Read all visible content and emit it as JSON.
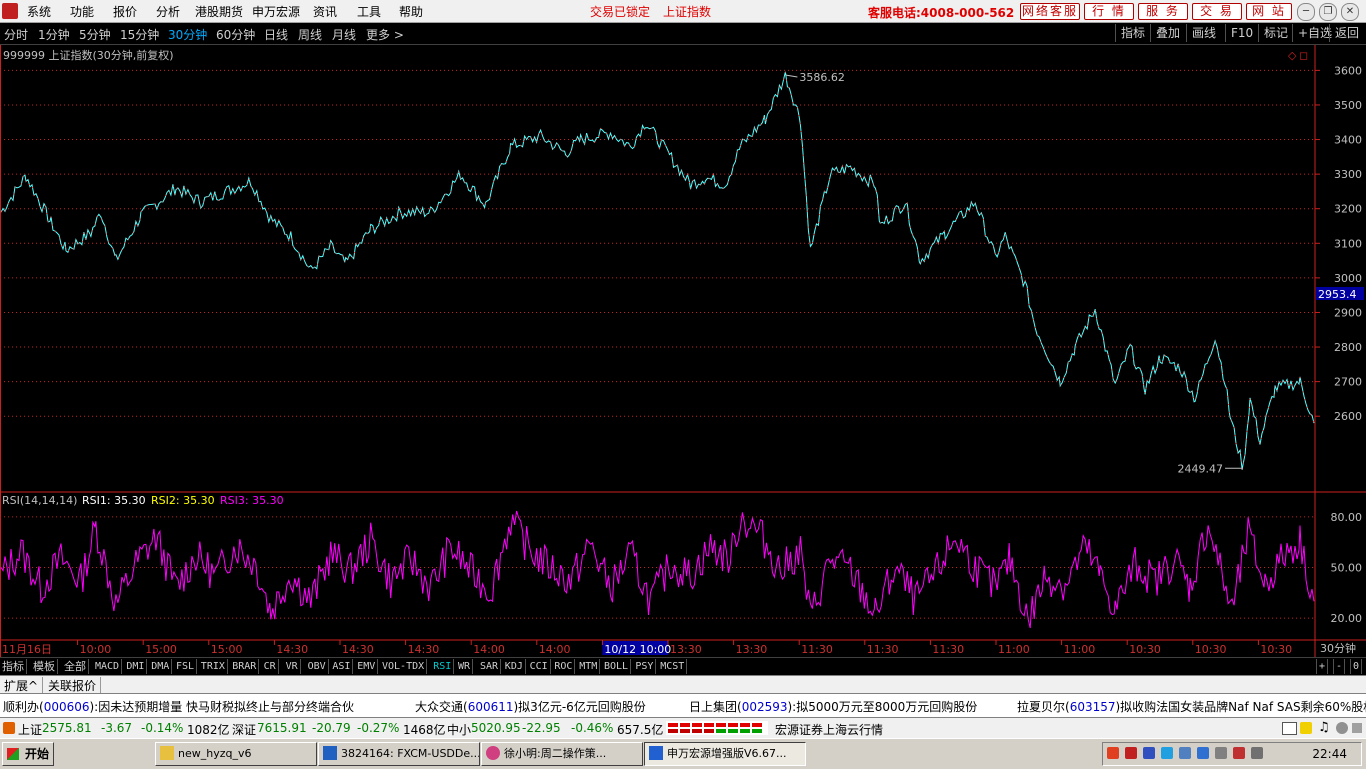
{
  "menubar": {
    "items": [
      "系统",
      "功能",
      "报价",
      "分析",
      "港股期货",
      "申万宏源",
      "资讯",
      "工具",
      "帮助"
    ],
    "lock_text": "交易已锁定",
    "index_name": "上证指数",
    "hotline": "客服电话:4008-000-562",
    "buttons": [
      "网络客服",
      "行 情",
      "服 务",
      "交 易",
      "网 站"
    ],
    "window_controls": [
      "─",
      "❐",
      "✕"
    ]
  },
  "periodbar": {
    "periods": [
      "分时",
      "1分钟",
      "5分钟",
      "15分钟",
      "30分钟",
      "60分钟",
      "日线",
      "周线",
      "月线",
      "更多 >"
    ],
    "active": "30分钟",
    "tools": [
      "指标",
      "叠加",
      "画线",
      "F10",
      "标记",
      "+自选",
      "返回"
    ]
  },
  "chart_title": "999999 上证指数(30分钟,前复权)",
  "rsi_legend": {
    "name": "RSI(14,14,14)",
    "rsi1": "RSI1: 35.30",
    "rsi2": "RSI2: 35.30",
    "rsi3": "RSI3: 35.30"
  },
  "price_tag": "2953.4",
  "period_label": "30分钟",
  "chart_data": {
    "type": "line",
    "title": "999999 上证指数(30分钟,前复权)",
    "price_axis": {
      "ticks": [
        2600,
        2700,
        2800,
        2900,
        3000,
        3100,
        3200,
        3300,
        3400,
        3500,
        3600
      ],
      "ylim": [
        2430,
        3630
      ]
    },
    "rsi_axis": {
      "ticks": [
        20,
        50,
        80
      ],
      "ylim": [
        10,
        90
      ]
    },
    "annotations": {
      "high": 3586.62,
      "low": 2449.47,
      "last": 2953.4
    },
    "x_labels": [
      "11月16日",
      "10:00",
      "15:00",
      "15:00",
      "14:30",
      "14:30",
      "14:30",
      "14:00",
      "14:00",
      "10/12 10:00",
      "13:30",
      "13:30",
      "11:30",
      "11:30",
      "11:30",
      "11:00",
      "11:00",
      "10:30",
      "10:30",
      "10:30"
    ],
    "highlighted_x_label": "10/12 10:00",
    "price_series": [
      {
        "i": 0,
        "y": 3190
      },
      {
        "i": 25,
        "y": 3295
      },
      {
        "i": 50,
        "y": 3160
      },
      {
        "i": 65,
        "y": 3080
      },
      {
        "i": 90,
        "y": 3130
      },
      {
        "i": 100,
        "y": 3190
      },
      {
        "i": 115,
        "y": 3050
      },
      {
        "i": 140,
        "y": 3180
      },
      {
        "i": 175,
        "y": 3260
      },
      {
        "i": 200,
        "y": 3220
      },
      {
        "i": 250,
        "y": 3280
      },
      {
        "i": 270,
        "y": 3170
      },
      {
        "i": 290,
        "y": 3120
      },
      {
        "i": 310,
        "y": 3020
      },
      {
        "i": 330,
        "y": 3090
      },
      {
        "i": 345,
        "y": 3040
      },
      {
        "i": 370,
        "y": 3140
      },
      {
        "i": 400,
        "y": 3190
      },
      {
        "i": 430,
        "y": 3190
      },
      {
        "i": 460,
        "y": 3300
      },
      {
        "i": 485,
        "y": 3210
      },
      {
        "i": 510,
        "y": 3380
      },
      {
        "i": 540,
        "y": 3410
      },
      {
        "i": 565,
        "y": 3360
      },
      {
        "i": 580,
        "y": 3400
      },
      {
        "i": 610,
        "y": 3420
      },
      {
        "i": 630,
        "y": 3380
      },
      {
        "i": 645,
        "y": 3450
      },
      {
        "i": 665,
        "y": 3370
      },
      {
        "i": 690,
        "y": 3270
      },
      {
        "i": 705,
        "y": 3290
      },
      {
        "i": 725,
        "y": 3270
      },
      {
        "i": 740,
        "y": 3380
      },
      {
        "i": 765,
        "y": 3460
      },
      {
        "i": 785,
        "y": 3586
      },
      {
        "i": 800,
        "y": 3460
      },
      {
        "i": 810,
        "y": 3080
      },
      {
        "i": 830,
        "y": 3300
      },
      {
        "i": 850,
        "y": 3320
      },
      {
        "i": 875,
        "y": 3270
      },
      {
        "i": 880,
        "y": 3150
      },
      {
        "i": 905,
        "y": 3220
      },
      {
        "i": 920,
        "y": 3050
      },
      {
        "i": 945,
        "y": 3130
      },
      {
        "i": 975,
        "y": 3220
      },
      {
        "i": 995,
        "y": 3060
      },
      {
        "i": 1005,
        "y": 3120
      },
      {
        "i": 1025,
        "y": 2980
      },
      {
        "i": 1035,
        "y": 2860
      },
      {
        "i": 1060,
        "y": 2700
      },
      {
        "i": 1075,
        "y": 2800
      },
      {
        "i": 1095,
        "y": 2910
      },
      {
        "i": 1115,
        "y": 2690
      },
      {
        "i": 1130,
        "y": 2800
      },
      {
        "i": 1145,
        "y": 2680
      },
      {
        "i": 1160,
        "y": 2770
      },
      {
        "i": 1180,
        "y": 2740
      },
      {
        "i": 1195,
        "y": 2650
      },
      {
        "i": 1215,
        "y": 2830
      },
      {
        "i": 1225,
        "y": 2700
      },
      {
        "i": 1230,
        "y": 2600
      },
      {
        "i": 1243,
        "y": 2449
      },
      {
        "i": 1250,
        "y": 2650
      },
      {
        "i": 1260,
        "y": 2530
      },
      {
        "i": 1275,
        "y": 2680
      },
      {
        "i": 1300,
        "y": 2700
      },
      {
        "i": 1314,
        "y": 2580
      }
    ],
    "rsi_series": [
      {
        "i": 0,
        "y": 45
      },
      {
        "i": 20,
        "y": 60
      },
      {
        "i": 40,
        "y": 38
      },
      {
        "i": 60,
        "y": 55
      },
      {
        "i": 80,
        "y": 42
      },
      {
        "i": 95,
        "y": 74
      },
      {
        "i": 115,
        "y": 28
      },
      {
        "i": 135,
        "y": 52
      },
      {
        "i": 155,
        "y": 68
      },
      {
        "i": 175,
        "y": 38
      },
      {
        "i": 195,
        "y": 57
      },
      {
        "i": 215,
        "y": 45
      },
      {
        "i": 235,
        "y": 63
      },
      {
        "i": 255,
        "y": 52
      },
      {
        "i": 270,
        "y": 24
      },
      {
        "i": 290,
        "y": 46
      },
      {
        "i": 310,
        "y": 30
      },
      {
        "i": 330,
        "y": 58
      },
      {
        "i": 350,
        "y": 48
      },
      {
        "i": 370,
        "y": 66
      },
      {
        "i": 390,
        "y": 42
      },
      {
        "i": 410,
        "y": 55
      },
      {
        "i": 430,
        "y": 38
      },
      {
        "i": 450,
        "y": 62
      },
      {
        "i": 470,
        "y": 48
      },
      {
        "i": 490,
        "y": 36
      },
      {
        "i": 510,
        "y": 78
      },
      {
        "i": 530,
        "y": 60
      },
      {
        "i": 550,
        "y": 50
      },
      {
        "i": 570,
        "y": 42
      },
      {
        "i": 590,
        "y": 64
      },
      {
        "i": 610,
        "y": 38
      },
      {
        "i": 630,
        "y": 58
      },
      {
        "i": 650,
        "y": 30
      },
      {
        "i": 670,
        "y": 52
      },
      {
        "i": 690,
        "y": 45
      },
      {
        "i": 710,
        "y": 62
      },
      {
        "i": 730,
        "y": 55
      },
      {
        "i": 740,
        "y": 80
      },
      {
        "i": 760,
        "y": 70
      },
      {
        "i": 780,
        "y": 48
      },
      {
        "i": 800,
        "y": 60
      },
      {
        "i": 810,
        "y": 20
      },
      {
        "i": 830,
        "y": 55
      },
      {
        "i": 850,
        "y": 48
      },
      {
        "i": 875,
        "y": 22
      },
      {
        "i": 895,
        "y": 50
      },
      {
        "i": 915,
        "y": 30
      },
      {
        "i": 935,
        "y": 46
      },
      {
        "i": 955,
        "y": 68
      },
      {
        "i": 975,
        "y": 50
      },
      {
        "i": 995,
        "y": 38
      },
      {
        "i": 1010,
        "y": 55
      },
      {
        "i": 1028,
        "y": 18
      },
      {
        "i": 1045,
        "y": 45
      },
      {
        "i": 1065,
        "y": 40
      },
      {
        "i": 1085,
        "y": 62
      },
      {
        "i": 1100,
        "y": 45
      },
      {
        "i": 1115,
        "y": 25
      },
      {
        "i": 1135,
        "y": 52
      },
      {
        "i": 1155,
        "y": 42
      },
      {
        "i": 1175,
        "y": 55
      },
      {
        "i": 1190,
        "y": 38
      },
      {
        "i": 1208,
        "y": 76
      },
      {
        "i": 1222,
        "y": 45
      },
      {
        "i": 1232,
        "y": 24
      },
      {
        "i": 1248,
        "y": 70
      },
      {
        "i": 1265,
        "y": 40
      },
      {
        "i": 1285,
        "y": 58
      },
      {
        "i": 1300,
        "y": 66
      },
      {
        "i": 1314,
        "y": 30
      }
    ]
  },
  "indicator_tabs": [
    "指标",
    "模板",
    "全部",
    "MACD",
    "DMI",
    "DMA",
    "FSL",
    "TRIX",
    "BRAR",
    "CR",
    "VR",
    "OBV",
    "ASI",
    "EMV",
    "VOL-TDX",
    "RSI",
    "WR",
    "SAR",
    "KDJ",
    "CCI",
    "ROC",
    "MTM",
    "BOLL",
    "PSY",
    "MCST"
  ],
  "indicator_active": "RSI",
  "zoom_controls": [
    "+",
    "-",
    "0"
  ],
  "extbar": [
    "扩展^",
    "关联报价"
  ],
  "news": [
    {
      "head": "顺利办(",
      "code": "000606",
      "tail": "):因未达预期增量 快马财税拟终止与部分终端合伙"
    },
    {
      "head": "大众交通(",
      "code": "600611",
      "tail": ")拟3亿元-6亿元回购股份"
    },
    {
      "head": "日上集团(",
      "code": "002593",
      "tail": "):拟5000万元至8000万元回购股份"
    },
    {
      "head": "拉夏贝尔(",
      "code": "603157",
      "tail": ")拟收购法国女装品牌Naf Naf SAS剩余60%股权"
    }
  ],
  "quotes": {
    "sh_label": "上证",
    "sh_value": "2575.81",
    "sh_change": "-3.67",
    "sh_pct": "-0.14%",
    "sh_vol": "1082亿",
    "sz_label": "深证",
    "sz_value": "7615.91",
    "sz_change": "-20.79",
    "sz_pct": "-0.27%",
    "sz_vol": "1468亿",
    "zx_label": "中小",
    "zx_value": "5020.95",
    "zx_change": "-22.95",
    "zx_pct": "-0.46%",
    "zx_vol": "657.5亿",
    "broker": "宏源证券上海云行情"
  },
  "taskbar": {
    "start": "开始",
    "tasks": [
      "new_hyzq_v6",
      "3824164: FXCM-USDDe...",
      "徐小明:周二操作策...",
      "申万宏源增强版V6.67..."
    ],
    "clock": "22:44"
  },
  "colors": {
    "axis_red": "#cc2020",
    "price_line": "#54ffff",
    "rsi_line": "#ff00ff",
    "rsi2_text": "#ffff00",
    "rsi3_text": "#ff00ff",
    "tag_bg": "#0000a0"
  }
}
